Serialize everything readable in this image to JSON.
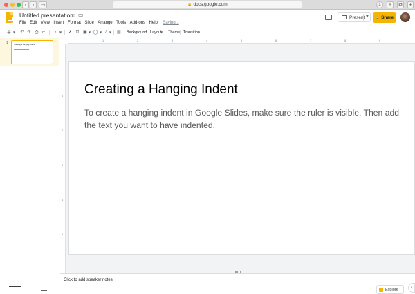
{
  "browser": {
    "url": "docs.google.com",
    "traffic_lights": [
      "#fe5f57",
      "#febc2e",
      "#28c840"
    ]
  },
  "header": {
    "title": "Untitled presentation",
    "menu": [
      "File",
      "Edit",
      "View",
      "Insert",
      "Format",
      "Slide",
      "Arrange",
      "Tools",
      "Add-ons",
      "Help"
    ],
    "status": "Saving...",
    "present_label": "Present",
    "share_label": "Share",
    "accent": "#f4b400"
  },
  "toolbar": {
    "background_label": "Background",
    "layout_label": "Layout",
    "theme_label": "Theme",
    "transition_label": "Transition"
  },
  "filmstrip": {
    "slides": [
      {
        "number": "1",
        "title": "Creating a Hanging Indent"
      }
    ]
  },
  "ruler": {
    "horizontal": [
      "1",
      "2",
      "3",
      "4",
      "5",
      "6",
      "7",
      "8",
      "9"
    ],
    "vertical": [
      "1",
      "2",
      "3",
      "4",
      "5"
    ]
  },
  "slide": {
    "title": "Creating a Hanging Indent",
    "body": "To create a hanging indent in Google Slides, make sure the ruler is visible. Then add the text you want to have indented."
  },
  "notes": {
    "placeholder": "Click to add speaker notes"
  },
  "explore": {
    "label": "Explore"
  }
}
